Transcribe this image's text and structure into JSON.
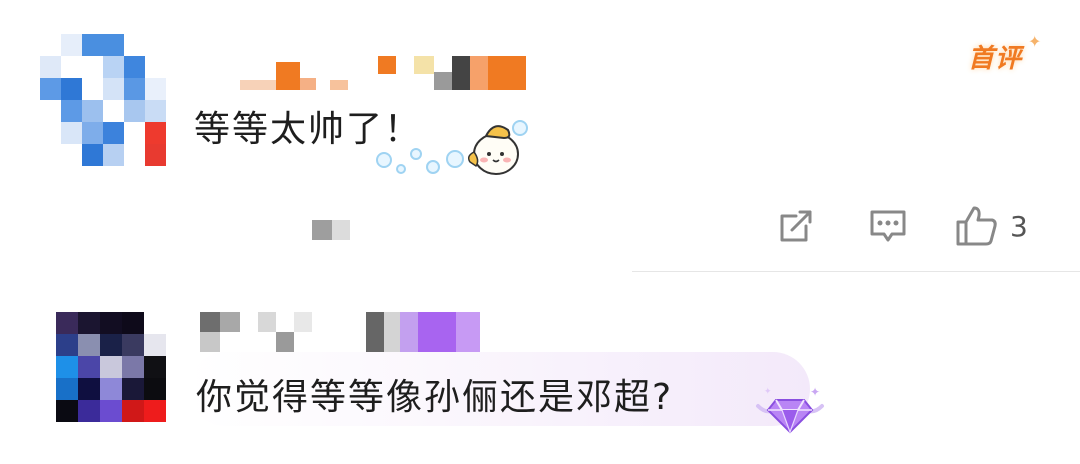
{
  "comments": [
    {
      "text": "等等太帅了！",
      "badge": "首评",
      "like_count": "3",
      "avatar_icon": "pixelated-avatar",
      "sticker_icon": "cartoon-bun-sticker"
    },
    {
      "text": "你觉得等等像孙俪还是邓超?",
      "avatar_icon": "pixelated-avatar",
      "gem_icon": "purple-diamond-badge-icon"
    }
  ],
  "icons": {
    "share": "share-icon",
    "reply": "reply-icon",
    "like": "thumbs-up-icon"
  },
  "colors": {
    "badge_orange": "#f07a22",
    "icon_gray": "#888888",
    "gem_purple": "#a864f0"
  }
}
